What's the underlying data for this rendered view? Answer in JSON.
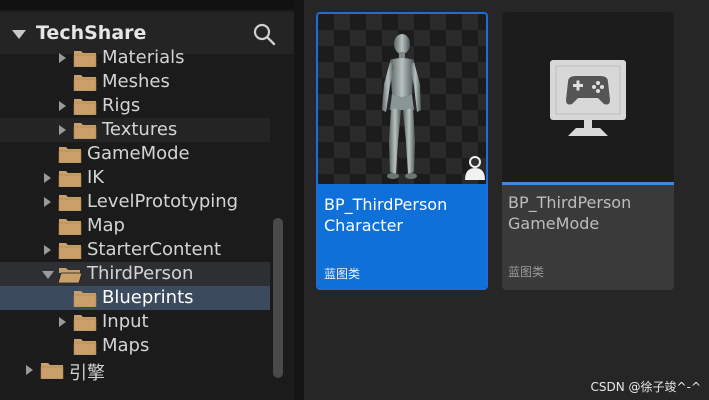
{
  "tree": {
    "root_label": "TechShare",
    "items": [
      {
        "label": "Materials",
        "arrow": "right",
        "indent": 2
      },
      {
        "label": "Meshes",
        "arrow": "none",
        "indent": 2
      },
      {
        "label": "Rigs",
        "arrow": "right",
        "indent": 2
      },
      {
        "label": "Textures",
        "arrow": "right",
        "indent": 2,
        "state": "hover"
      },
      {
        "label": "GameMode",
        "arrow": "none",
        "indent": 1
      },
      {
        "label": "IK",
        "arrow": "right",
        "indent": 1
      },
      {
        "label": "LevelPrototyping",
        "arrow": "right",
        "indent": 1
      },
      {
        "label": "Map",
        "arrow": "none",
        "indent": 1
      },
      {
        "label": "StarterContent",
        "arrow": "right",
        "indent": 1
      },
      {
        "label": "ThirdPerson",
        "arrow": "down",
        "indent": 1,
        "state": "parent",
        "open": true
      },
      {
        "label": "Blueprints",
        "arrow": "none",
        "indent": 2,
        "state": "selected"
      },
      {
        "label": "Input",
        "arrow": "right",
        "indent": 2
      },
      {
        "label": "Maps",
        "arrow": "none",
        "indent": 2
      },
      {
        "label": "引擎",
        "arrow": "right",
        "indent": 0
      }
    ]
  },
  "assets": [
    {
      "name_line1": "BP_ThirdPerson",
      "name_line2": "Character",
      "type_label": "蓝图类",
      "icon": "character-mannequin-icon",
      "selected": true
    },
    {
      "name_line1": "BP_ThirdPerson",
      "name_line2": "GameMode",
      "type_label": "蓝图类",
      "icon": "gamemode-monitor-icon",
      "selected": false
    }
  ],
  "colors": {
    "accent": "#0e70d8",
    "folder": "#c9a06a",
    "panel": "#1b1b1b"
  },
  "watermark": "CSDN @徐子竣^-^"
}
